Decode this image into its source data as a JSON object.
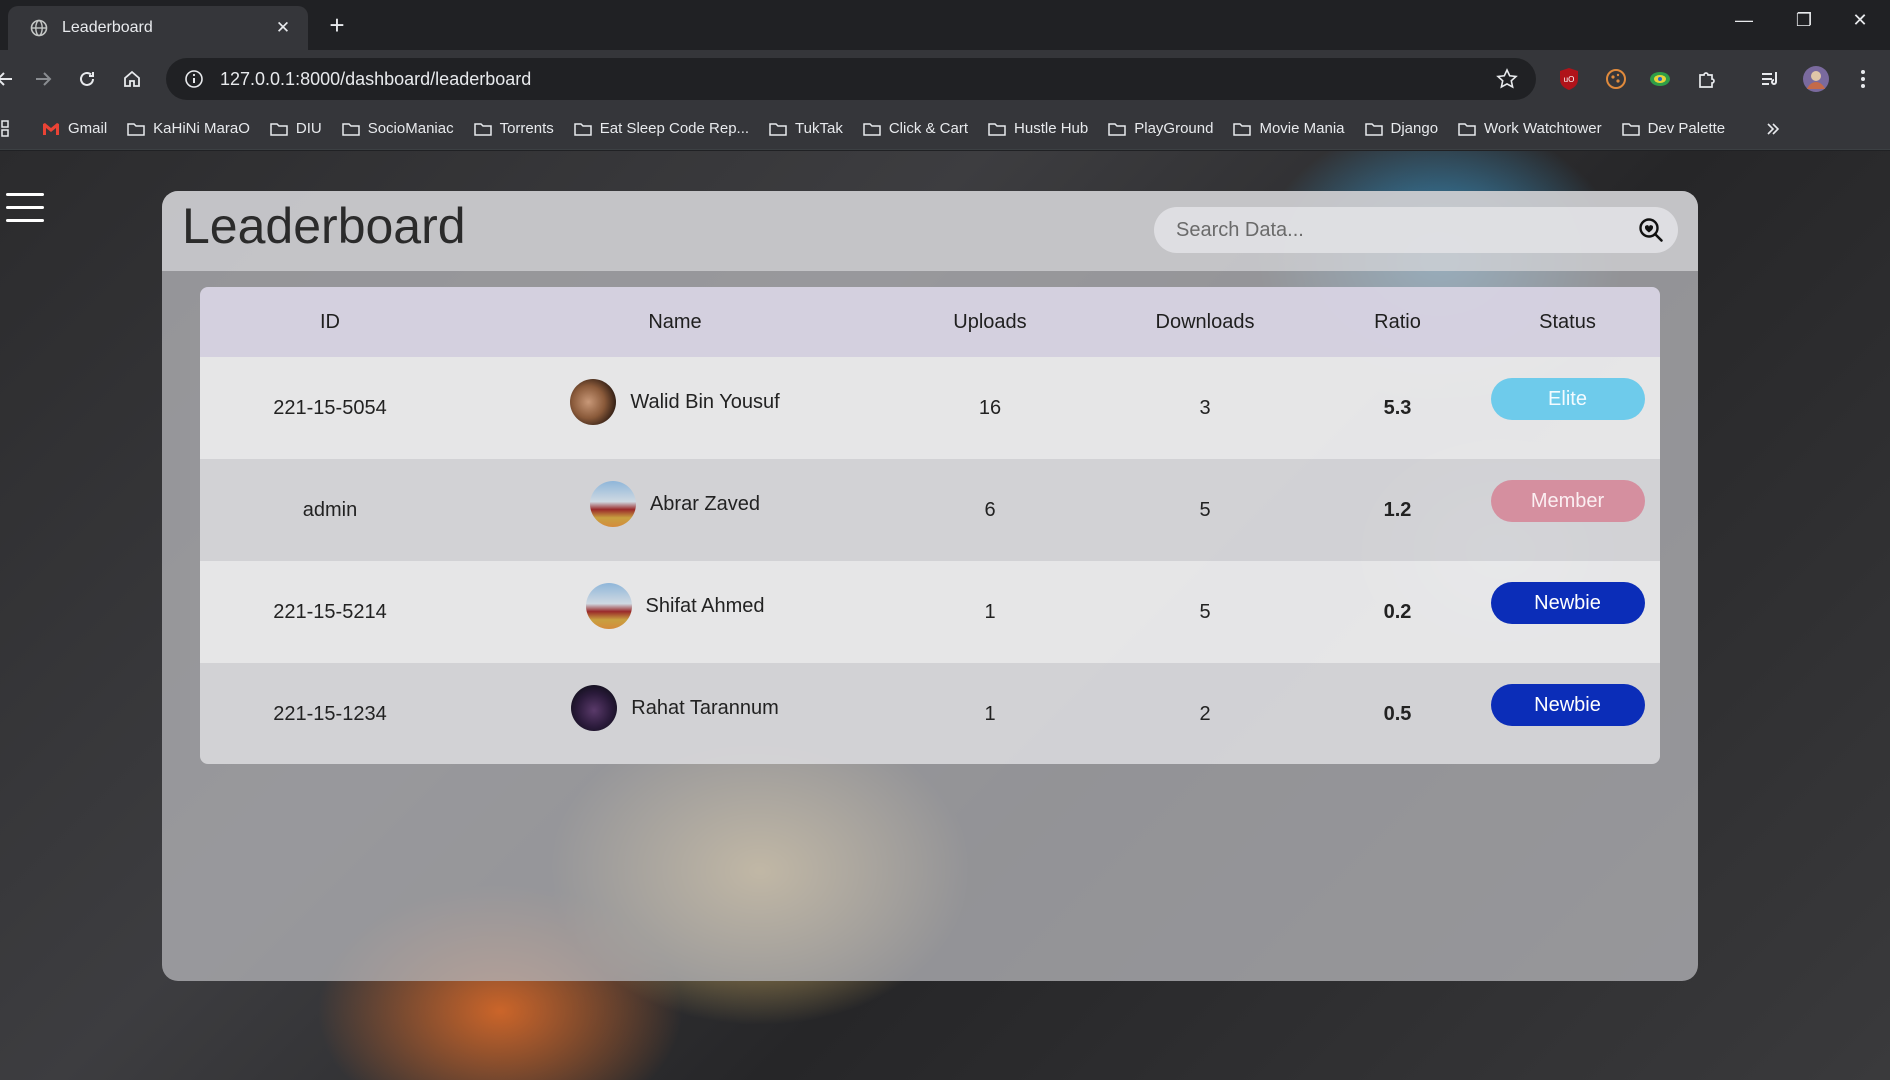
{
  "browser": {
    "tab_title": "Leaderboard",
    "url": "127.0.0.1:8000/dashboard/leaderboard",
    "bookmarks": [
      {
        "label": "Gmail",
        "icon": "gmail-icon"
      },
      {
        "label": "KaHiNi MaraO",
        "icon": "folder-icon"
      },
      {
        "label": "DIU",
        "icon": "folder-icon"
      },
      {
        "label": "SocioManiac",
        "icon": "folder-icon"
      },
      {
        "label": "Torrents",
        "icon": "folder-icon"
      },
      {
        "label": "Eat Sleep Code Rep...",
        "icon": "folder-icon"
      },
      {
        "label": "TukTak",
        "icon": "folder-icon"
      },
      {
        "label": "Click & Cart",
        "icon": "folder-icon"
      },
      {
        "label": "Hustle Hub",
        "icon": "folder-icon"
      },
      {
        "label": "PlayGround",
        "icon": "folder-icon"
      },
      {
        "label": "Movie Mania",
        "icon": "folder-icon"
      },
      {
        "label": "Django",
        "icon": "folder-icon"
      },
      {
        "label": "Work Watchtower",
        "icon": "folder-icon"
      },
      {
        "label": "Dev Palette",
        "icon": "folder-icon"
      }
    ]
  },
  "page": {
    "title": "Leaderboard",
    "search_placeholder": "Search Data..."
  },
  "table": {
    "headers": {
      "id": "ID",
      "name": "Name",
      "uploads": "Uploads",
      "downloads": "Downloads",
      "ratio": "Ratio",
      "status": "Status"
    },
    "rows": [
      {
        "id": "221-15-5054",
        "name": "Walid Bin Yousuf",
        "uploads": "16",
        "downloads": "3",
        "ratio": "5.3",
        "status": "Elite"
      },
      {
        "id": "admin",
        "name": "Abrar Zaved",
        "uploads": "6",
        "downloads": "5",
        "ratio": "1.2",
        "status": "Member"
      },
      {
        "id": "221-15-5214",
        "name": "Shifat Ahmed",
        "uploads": "1",
        "downloads": "5",
        "ratio": "0.2",
        "status": "Newbie"
      },
      {
        "id": "221-15-1234",
        "name": "Rahat Tarannum",
        "uploads": "1",
        "downloads": "2",
        "ratio": "0.5",
        "status": "Newbie"
      }
    ]
  },
  "colors": {
    "elite": "#6ecbeb",
    "member": "#d58f9f",
    "newbie": "#0b2db8"
  }
}
